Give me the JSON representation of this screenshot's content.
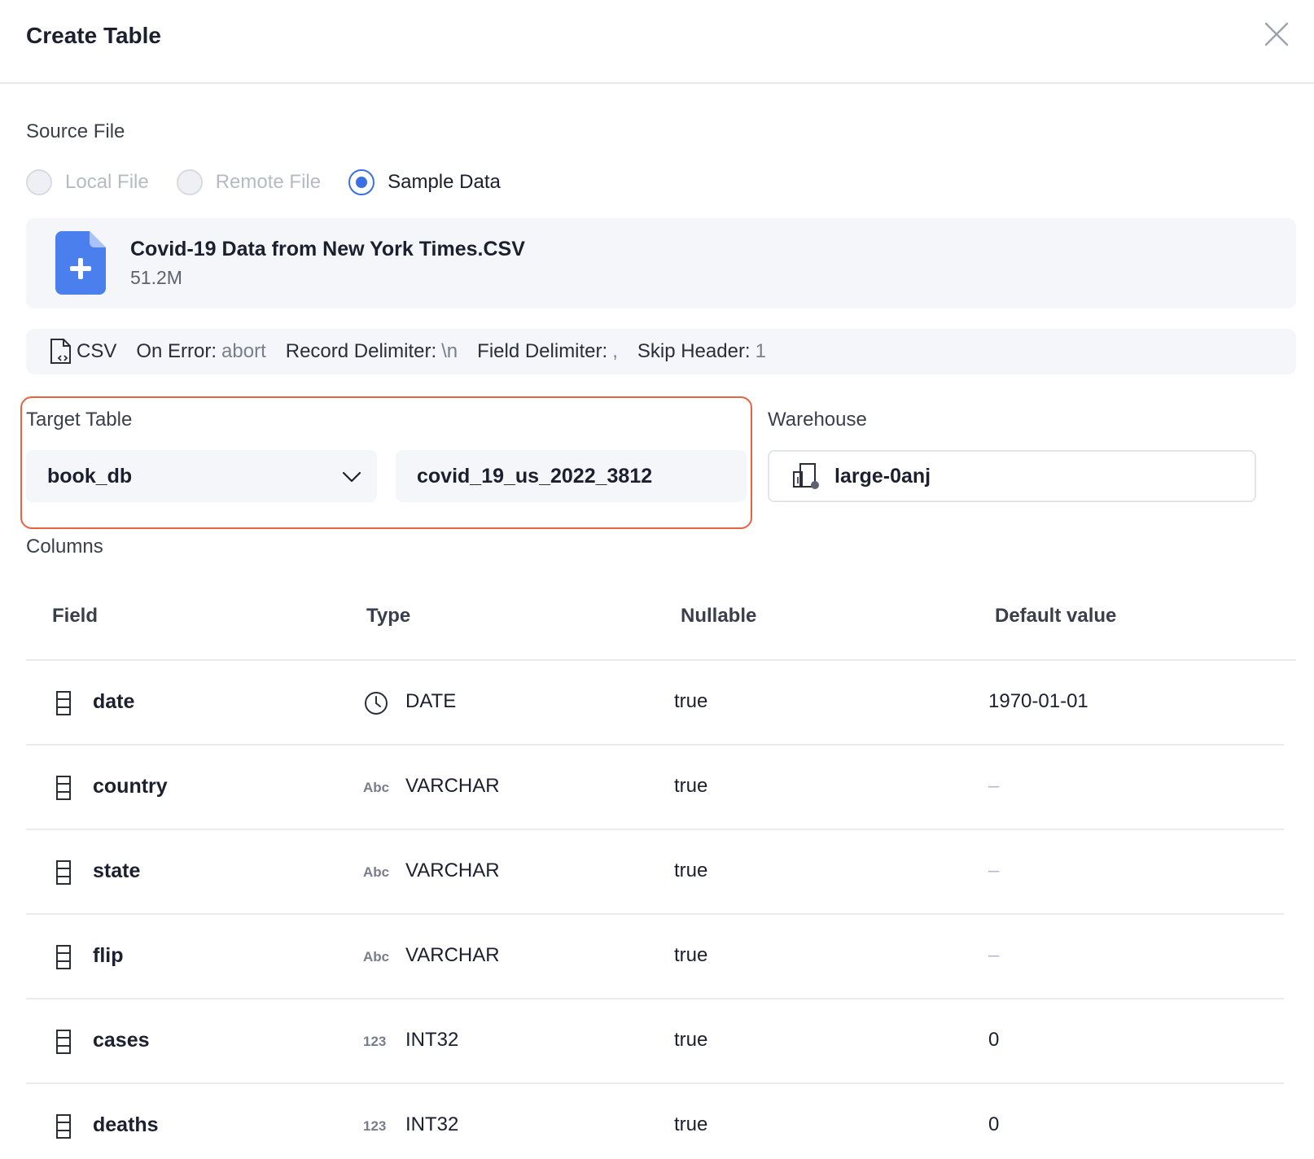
{
  "dialog": {
    "title": "Create Table"
  },
  "source": {
    "label": "Source File",
    "options": [
      "Local File",
      "Remote File",
      "Sample Data"
    ],
    "selected": "Sample Data"
  },
  "file": {
    "name": "Covid-19 Data from New York Times.CSV",
    "size": "51.2M"
  },
  "format_options": {
    "format": "CSV",
    "on_error_label": "On Error:",
    "on_error": "abort",
    "record_delimiter_label": "Record Delimiter:",
    "record_delimiter": "\\n",
    "field_delimiter_label": "Field Delimiter:",
    "field_delimiter": ",",
    "skip_header_label": "Skip Header:",
    "skip_header": "1"
  },
  "target": {
    "label": "Target Table",
    "database": "book_db",
    "table": "covid_19_us_2022_3812"
  },
  "warehouse": {
    "label": "Warehouse",
    "value": "large-0anj"
  },
  "columns": {
    "label": "Columns",
    "headers": [
      "Field",
      "Type",
      "Nullable",
      "Default value"
    ],
    "rows": [
      {
        "field": "date",
        "type_icon": "clock-icon",
        "type": "DATE",
        "nullable": "true",
        "default": "1970-01-01"
      },
      {
        "field": "country",
        "type_icon": "Abc",
        "type": "VARCHAR",
        "nullable": "true",
        "default": "–"
      },
      {
        "field": "state",
        "type_icon": "Abc",
        "type": "VARCHAR",
        "nullable": "true",
        "default": "–"
      },
      {
        "field": "flip",
        "type_icon": "Abc",
        "type": "VARCHAR",
        "nullable": "true",
        "default": "–"
      },
      {
        "field": "cases",
        "type_icon": "123",
        "type": "INT32",
        "nullable": "true",
        "default": "0"
      },
      {
        "field": "deaths",
        "type_icon": "123",
        "type": "INT32",
        "nullable": "true",
        "default": "0"
      }
    ]
  },
  "colors": {
    "accent": "#3b6fe8",
    "highlight_border": "#e9623f",
    "surface": "#f4f6fa"
  }
}
